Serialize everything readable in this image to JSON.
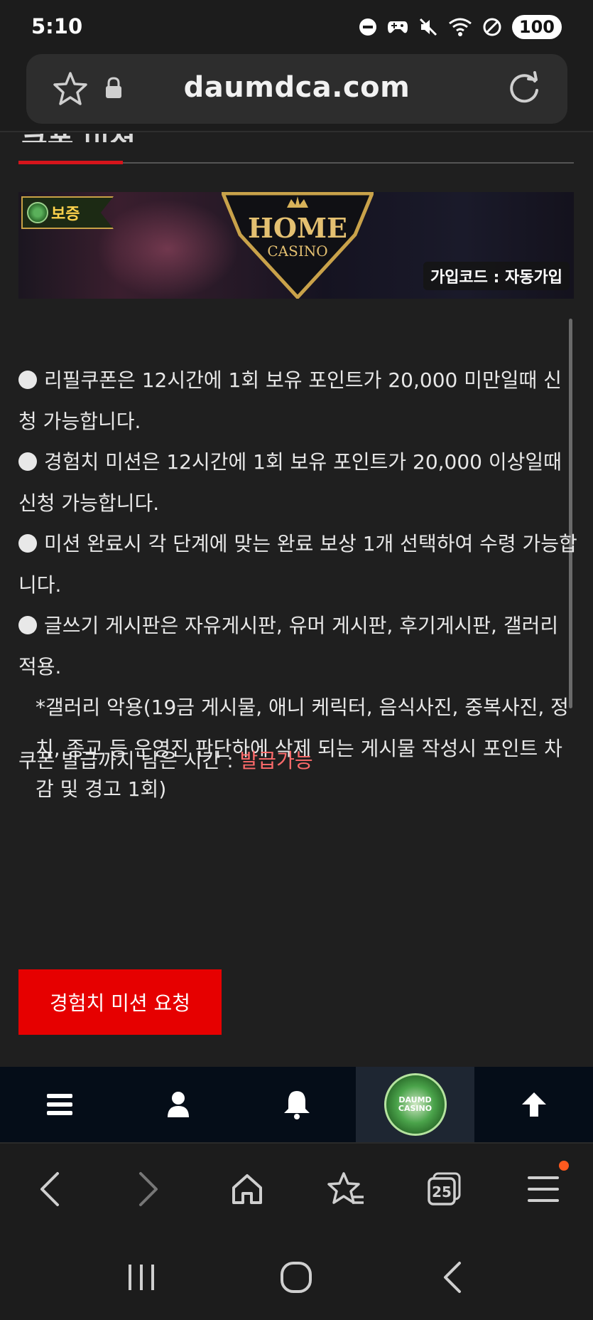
{
  "status_bar": {
    "time": "5:10",
    "battery": "100",
    "icons": [
      "dnd-icon",
      "game-icon",
      "mute-icon",
      "wifi-icon",
      "blocked-icon"
    ]
  },
  "browser": {
    "url": "daumdca.com"
  },
  "page": {
    "tab_title_fragment": "쿠폰 미션",
    "banner": {
      "badge_text": "보증",
      "logo_line1": "HOME",
      "logo_line2": "CASINO",
      "join_code": "가입코드 : 자동가입"
    },
    "notes": [
      "리필쿠폰은 12시간에 1회 보유 포인트가 20,000 미만일때 신청 가능합니다.",
      "경험치 미션은 12시간에 1회 보유 포인트가 20,000 이상일때 신청 가능합니다.",
      "미션 완료시 각 단계에 맞는 완료 보상 1개 선택하여 수령 가능합니다.",
      "글쓰기 게시판은 자유게시판, 유머 게시판, 후기게시판, 갤러리 적용."
    ],
    "note_extra": "*갤러리 악용(19금 게시물, 애니 케릭터, 음식사진, 중복사진, 정치, 종교 등 운영진 판단하에 삭제 되는 게시물 작성시 포인트 차감 및 경고 1회)",
    "coupon_label": "쿠폰 발급까지 남은 시간 : ",
    "coupon_status": "발급가능",
    "mission_button": "경험치 미션 요청"
  },
  "site_nav": {
    "logo_line1": "DAUMD",
    "logo_line2": "CASINO"
  },
  "browser_toolbar": {
    "tabs_count": "25"
  },
  "colors": {
    "accent_red": "#e60000",
    "status_pink": "#ff6b6b",
    "underline_red": "#d6141b"
  }
}
